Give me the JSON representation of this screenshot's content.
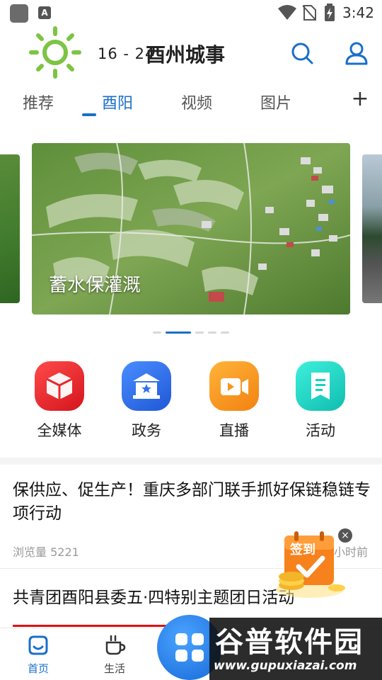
{
  "status_bar": {
    "time": "3:42",
    "icons": [
      "app-icon",
      "a-icon",
      "wifi-icon",
      "no-sim-icon",
      "battery-icon"
    ]
  },
  "header": {
    "temperature": "16 - 24",
    "title": "酉州城事",
    "weather_icon": "sun-icon",
    "search_icon": "search-icon",
    "user_icon": "user-icon"
  },
  "tabs": {
    "items": [
      {
        "label": "推荐",
        "active": false
      },
      {
        "label": "酉阳",
        "active": true
      },
      {
        "label": "视频",
        "active": false
      },
      {
        "label": "图片",
        "active": false
      }
    ],
    "add_label": "+"
  },
  "banner": {
    "caption": "蓄水保灌溉",
    "page_count": 5,
    "active_index": 1
  },
  "quick_entries": [
    {
      "label": "全媒体",
      "icon": "cube-icon",
      "color": "#e8282e"
    },
    {
      "label": "政务",
      "icon": "government-building-icon",
      "color": "#2f6fe8"
    },
    {
      "label": "直播",
      "icon": "video-camera-icon",
      "color": "#f7951e"
    },
    {
      "label": "活动",
      "icon": "document-icon",
      "color": "#16d2c2"
    }
  ],
  "articles": [
    {
      "title": "保供应、促生产！重庆多部门联手抓好保链稳链专项行动",
      "views": "浏览量 5221",
      "time": "小时前"
    },
    {
      "title": "共青团酉阳县委五·四特别主题团日活动"
    }
  ],
  "promo": {
    "label": "签到",
    "close_label": "×"
  },
  "bottom_nav": {
    "items": [
      {
        "label": "首页",
        "icon": "home-icon",
        "active": true
      },
      {
        "label": "生活",
        "icon": "coffee-cup-icon",
        "active": false
      }
    ],
    "center_icon": "grid-icon"
  },
  "watermark": {
    "text": "谷普软件园",
    "url": "www.gupuxiazai.com"
  },
  "colors": {
    "accent": "#1a6fc9",
    "weather": "#7dc443"
  }
}
